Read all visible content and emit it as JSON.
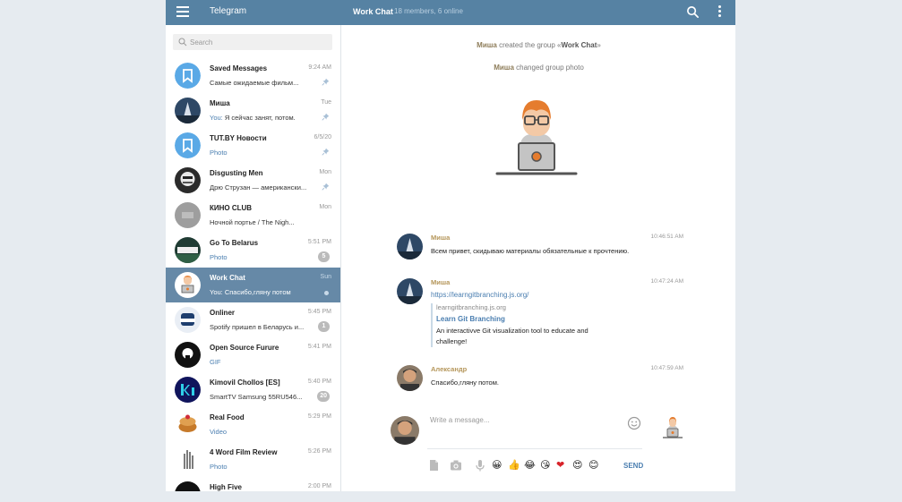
{
  "header": {
    "brand": "Telegram",
    "chat_title": "Work Chat",
    "chat_subtitle": "18 members, 6 online"
  },
  "search": {
    "placeholder": "Search"
  },
  "dialogs": [
    {
      "name": "Saved Messages",
      "time": "9:24 AM",
      "preview": "Самые ожидаемые фильм...",
      "preview_style": "normal",
      "pinned": true,
      "avatar": "bookmark-icon"
    },
    {
      "name": "Миша",
      "time": "Tue",
      "preview": "You: Я сейчас занят, потом.",
      "preview_style": "you",
      "pinned": true,
      "avatar": "photo"
    },
    {
      "name": "TUT.BY Новости",
      "time": "6/5/20",
      "preview": "Photo",
      "preview_style": "blue",
      "pinned": true,
      "avatar": "bookmark-icon"
    },
    {
      "name": "Disgusting Men",
      "time": "Mon",
      "preview": "Дрю Струзан — американски...",
      "preview_style": "normal",
      "pinned": true,
      "avatar": "photo"
    },
    {
      "name": "КИНО CLUB",
      "time": "Mon",
      "preview": "Ночной портье / The Nigh...",
      "preview_style": "normal",
      "avatar": "photo"
    },
    {
      "name": "Go To Belarus",
      "time": "5:51 PM",
      "preview": "Photo",
      "preview_style": "blue",
      "badge": "5",
      "avatar": "photo"
    },
    {
      "name": "Work Chat",
      "time": "Sun",
      "preview": "You: Спасибо,гляну потом",
      "preview_style": "you",
      "active": true,
      "avatar": "photo"
    },
    {
      "name": "Onliner",
      "time": "5:45 PM",
      "preview": "Spotify пришел в Беларусь и...",
      "preview_style": "normal",
      "badge": "1",
      "avatar": "photo"
    },
    {
      "name": "Open Source Furure",
      "time": "5:41 PM",
      "preview": "GIF",
      "preview_style": "blue",
      "avatar": "photo"
    },
    {
      "name": "Kimovil Chollos [ES]",
      "time": "5:40 PM",
      "preview": "SmartTV Samsung 55RU546...",
      "preview_style": "normal",
      "badge": "20",
      "avatar": "photo"
    },
    {
      "name": "Real Food",
      "time": "5:29 PM",
      "preview": "Video",
      "preview_style": "blue",
      "avatar": "photo"
    },
    {
      "name": "4 Word Film Review",
      "time": "5:26 PM",
      "preview": "Photo",
      "preview_style": "blue",
      "avatar": "photo"
    },
    {
      "name": "High Five",
      "time": "2:00 PM",
      "preview": "",
      "preview_style": "normal",
      "avatar": "photo"
    }
  ],
  "service": {
    "created_author": "Миша",
    "created_text": "created the group «",
    "created_group": "Work Chat",
    "created_end": "»",
    "photo_author": "Миша",
    "photo_text": "changed group photo"
  },
  "messages": [
    {
      "author": "Миша",
      "time": "10:46:51 AM",
      "text": "Всем привет, скидываю материалы обязательные к прочтению."
    },
    {
      "author": "Миша",
      "time": "10:47:24 AM",
      "link": "https://learngitbranching.js.org/",
      "preview_site": "learngitbranching.js.org",
      "preview_title": "Learn Git Branching",
      "preview_desc": "An interactivve Git visualization tool to educate and challenge!"
    },
    {
      "author": "Александр",
      "time": "10:47:59 AM",
      "text": "Спасибо,гляну потом."
    }
  ],
  "composer": {
    "placeholder": "Write a message...",
    "send_label": "SEND",
    "emoji": [
      "😀",
      "👍",
      "😂",
      "😘",
      "❤",
      "😍",
      "😊"
    ]
  },
  "colors": {
    "header": "#5682a3",
    "active_dialog": "#6689a7",
    "link": "#4a7eb0",
    "author": "#b5965a"
  }
}
